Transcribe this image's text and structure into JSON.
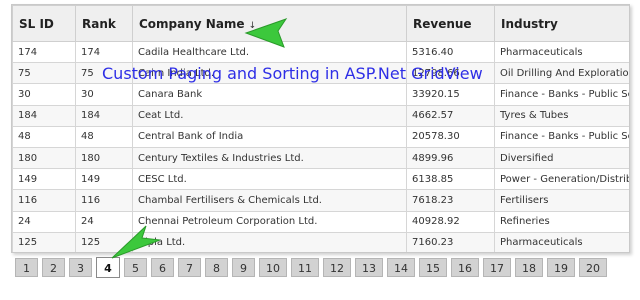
{
  "grid": {
    "columns": [
      "SL ID",
      "Rank",
      "Company Name",
      "Revenue",
      "Industry"
    ],
    "sort_indicator": "↓",
    "rows": [
      [
        "174",
        "174",
        "Cadila Healthcare Ltd.",
        "5316.40",
        "Pharmaceuticals"
      ],
      [
        "75",
        "75",
        "Cairn India Ltd.",
        "12798.66",
        "Oil Drilling And Exploration"
      ],
      [
        "30",
        "30",
        "Canara Bank",
        "33920.15",
        "Finance - Banks - Public Sector"
      ],
      [
        "184",
        "184",
        "Ceat Ltd.",
        "4662.57",
        "Tyres & Tubes"
      ],
      [
        "48",
        "48",
        "Central Bank of India",
        "20578.30",
        "Finance - Banks - Public Sector"
      ],
      [
        "180",
        "180",
        "Century Textiles & Industries Ltd.",
        "4899.96",
        "Diversified"
      ],
      [
        "149",
        "149",
        "CESC Ltd.",
        "6138.85",
        "Power - Generation/Distribution"
      ],
      [
        "116",
        "116",
        "Chambal Fertilisers & Chemicals Ltd.",
        "7618.23",
        "Fertilisers"
      ],
      [
        "24",
        "24",
        "Chennai Petroleum Corporation Ltd.",
        "40928.92",
        "Refineries"
      ],
      [
        "125",
        "125",
        "Cipla Ltd.",
        "7160.23",
        "Pharmaceuticals"
      ]
    ]
  },
  "overlay": {
    "title": "Custom Paging and Sorting in ASP.Net GridView",
    "title_color": "#2e2ee6",
    "arrow_color": "#3cc83c"
  },
  "pager": {
    "pages": [
      "1",
      "2",
      "3",
      "4",
      "5",
      "6",
      "7",
      "8",
      "9",
      "10",
      "11",
      "12",
      "13",
      "14",
      "15",
      "16",
      "17",
      "18",
      "19",
      "20"
    ],
    "current": "4"
  }
}
